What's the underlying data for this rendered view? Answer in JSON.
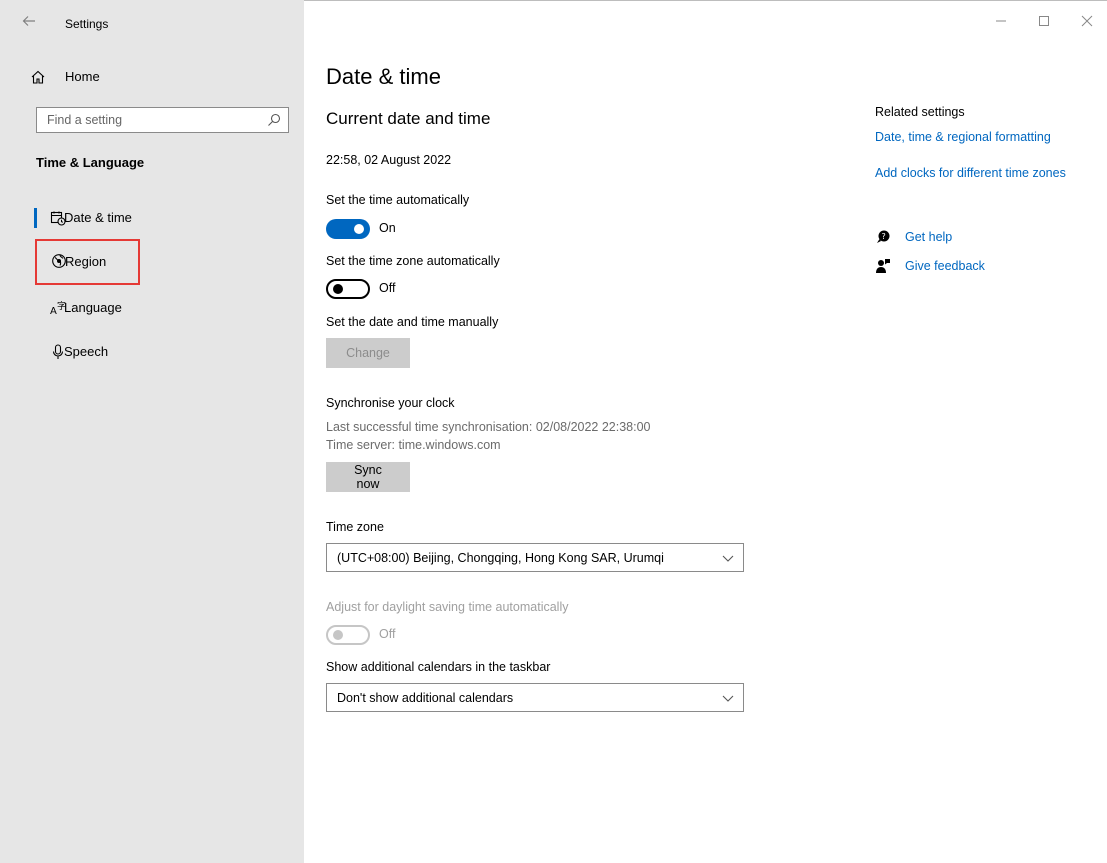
{
  "window": {
    "title": "Settings",
    "controls": [
      "minimize",
      "maximize",
      "close"
    ]
  },
  "sidebar": {
    "home_label": "Home",
    "search": {
      "placeholder": "Find a setting",
      "value": ""
    },
    "section_heading": "Time & Language",
    "items": [
      {
        "label": "Date & time",
        "icon": "calendar-clock-icon",
        "active": true
      },
      {
        "label": "Region",
        "icon": "globe-region-icon",
        "highlighted": true
      },
      {
        "label": "Language",
        "icon": "language-icon"
      },
      {
        "label": "Speech",
        "icon": "microphone-icon"
      }
    ]
  },
  "main": {
    "title": "Date & time",
    "subtitle": "Current date and time",
    "current_datetime": "22:58, 02 August 2022",
    "auto_time": {
      "label": "Set the time automatically",
      "state": "On"
    },
    "auto_timezone": {
      "label": "Set the time zone automatically",
      "state": "Off"
    },
    "manual": {
      "label": "Set the date and time manually",
      "button": "Change"
    },
    "sync": {
      "title": "Synchronise your clock",
      "last_sync": "Last successful time synchronisation: 02/08/2022 22:38:00",
      "server": "Time server: time.windows.com",
      "button": "Sync now"
    },
    "timezone": {
      "label": "Time zone",
      "value": "(UTC+08:00) Beijing, Chongqing, Hong Kong SAR, Urumqi"
    },
    "dst": {
      "label": "Adjust for daylight saving time automatically",
      "state": "Off"
    },
    "calendars": {
      "label": "Show additional calendars in the taskbar",
      "value": "Don't show additional calendars"
    }
  },
  "related": {
    "title": "Related settings",
    "links": [
      "Date, time & regional formatting",
      "Add clocks for different time zones"
    ],
    "help": "Get help",
    "feedback": "Give feedback"
  },
  "colors": {
    "accent": "#0067c0",
    "sidebar_bg": "#e6e6e6",
    "highlight": "#e53935"
  }
}
